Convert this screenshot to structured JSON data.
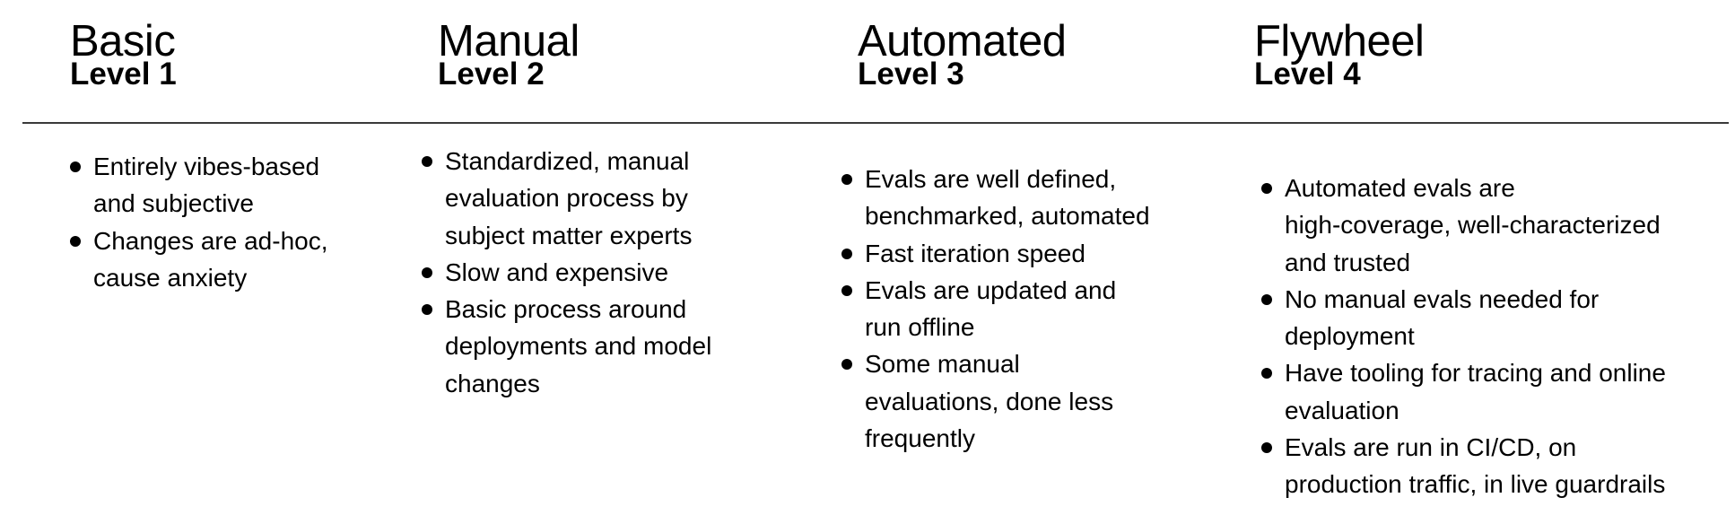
{
  "levels": [
    {
      "title": "Basic",
      "level": "Level 1",
      "bullets": [
        "Entirely vibes-based\nand subjective",
        "Changes are ad-hoc,\ncause anxiety"
      ]
    },
    {
      "title": "Manual",
      "level": "Level 2",
      "bullets": [
        "Standardized, manual\nevaluation process by\nsubject matter experts",
        "Slow and expensive",
        "Basic process around\ndeployments and model\nchanges"
      ]
    },
    {
      "title": "Automated",
      "level": "Level 3",
      "bullets": [
        "Evals are well defined,\nbenchmarked, automated",
        "Fast iteration speed",
        "Evals are updated and\nrun offline",
        "Some manual\nevaluations, done less\nfrequently"
      ]
    },
    {
      "title": "Flywheel",
      "level": "Level 4",
      "bullets": [
        "Automated evals are\nhigh-coverage, well-characterized\nand trusted",
        "No manual evals needed for\ndeployment",
        "Have tooling for tracing and online\nevaluation",
        "Evals are run in CI/CD, on\nproduction traffic, in live guardrails"
      ]
    }
  ]
}
